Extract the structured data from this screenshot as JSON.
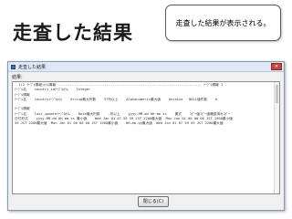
{
  "slide": {
    "title": "走査した結果",
    "callout": "走査した結果が表示される。"
  },
  "window": {
    "title": "走査した結果",
    "close_glyph": "✕"
  },
  "result": {
    "label": "結果:",
    "lines": [
      "  1(2 ﾃｰﾌﾞﾙ情報)ｶﾗﾑ情報 ----------------------------------------------------------------------- ﾃｰﾌﾞﾙ情報 1 -",
      "ﾃｰﾌﾞﾙ名    country_idﾃｰﾌﾞﾙｶﾗﾑ    Integer",
      "ﾃｰﾌﾞﾙ情報",
      "ﾃｰﾌﾞﾙ名    countryﾃｰﾌﾞﾙｶﾗﾑ    String最大桁数    37桁以上    Alphanumeric最大値    Ukraine   NULL値件数    0",
      "",
      "ﾃｰﾌﾞﾙ情報",
      "ﾃｰﾌﾞﾙ名    last_updateﾃｰﾌﾞﾙｶﾗﾑ    Date最大桁数    -桁以上    yyyy-MM-dd HH mm ss    書式    ｺﾋﾟｰ値ｺﾋﾟｰ値確認済みｺﾋﾟｰ",
      "日付形式    yyyy-MM-dd HH mm ss 最小値    Wed Jan 01 07 59 59 JST 2200最大値  Mon Jan 01 00 00 00 JST 1900最小値",
      "59 JST 2200最大値  Mon Jan 01 00 00 00 JST 1900最小値    HH-mm-yy最大値  Wed Jan 01 07 59 59 JST 2200最大値"
    ]
  },
  "footer": {
    "close_label": "閉じる(C)"
  }
}
